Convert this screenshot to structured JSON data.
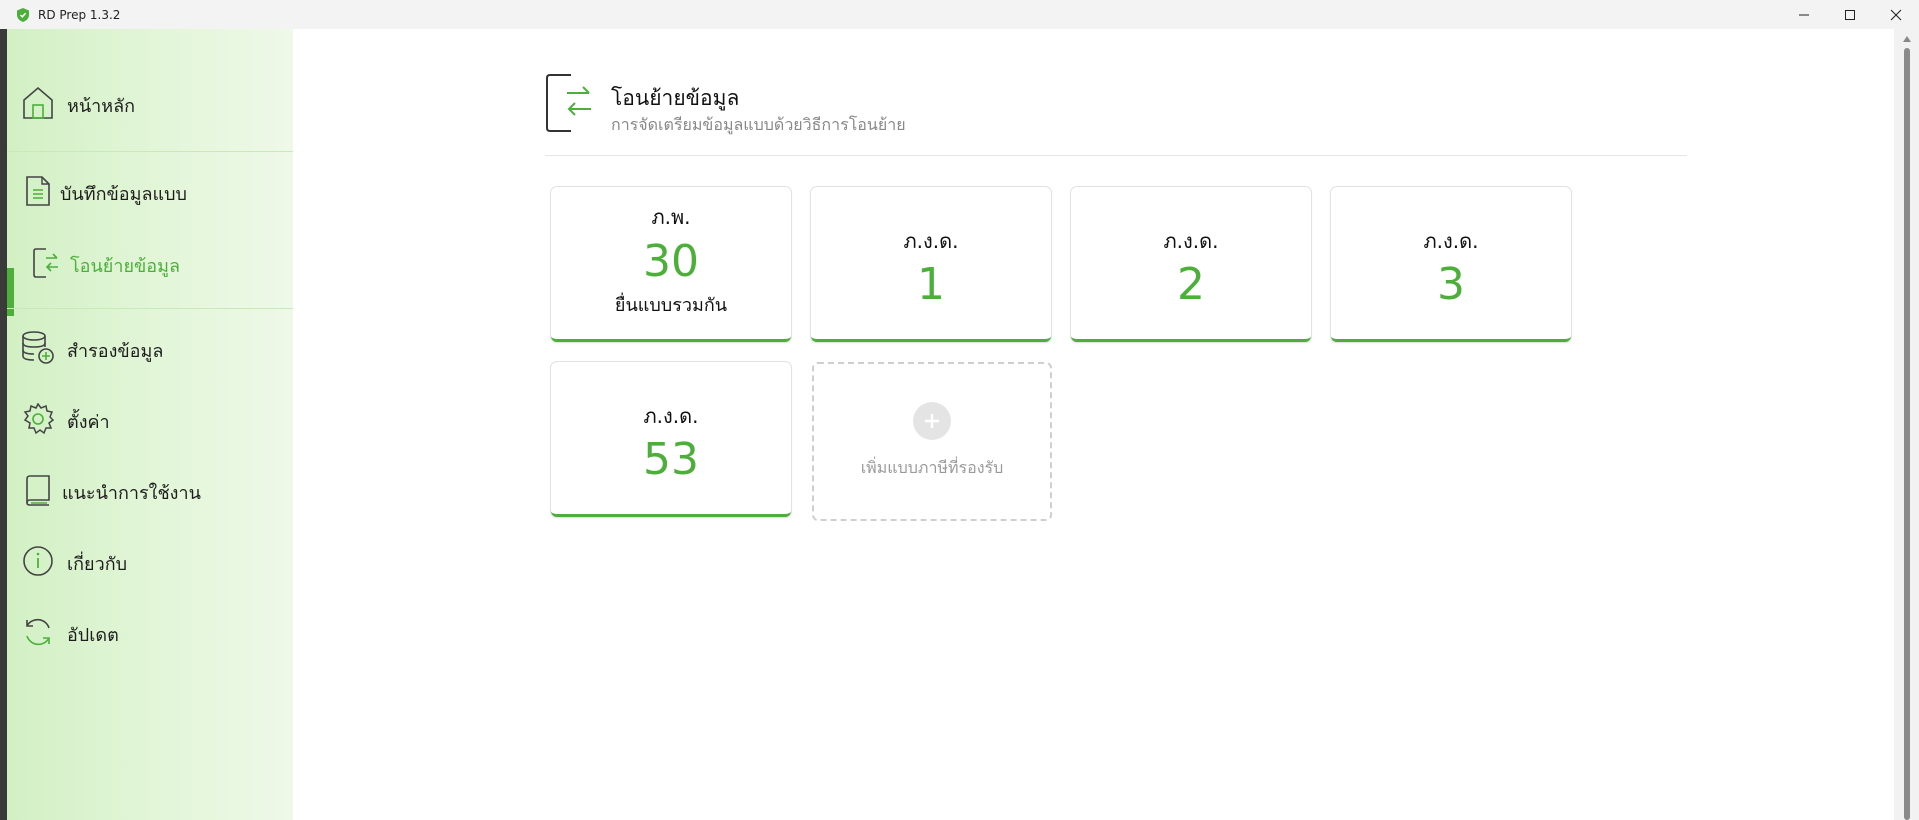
{
  "window": {
    "title": "RD Prep 1.3.2",
    "controls": [
      "minimize",
      "maximize",
      "close"
    ]
  },
  "colors": {
    "accent": "#4caf3a",
    "sidebar_bg": "#e3f6d9",
    "text_primary": "#111111",
    "text_muted": "#888888"
  },
  "sidebar": {
    "items": [
      {
        "label": "หน้าหลัก",
        "icon": "home-icon"
      },
      {
        "label": "บันทึกข้อมูลแบบ",
        "icon": "document-icon"
      },
      {
        "label": "โอนย้ายข้อมูล",
        "icon": "transfer-icon",
        "active": true
      },
      {
        "label": "สำรองข้อมูล",
        "icon": "database-backup-icon"
      },
      {
        "label": "ตั้งค่า",
        "icon": "gear-icon"
      },
      {
        "label": "แนะนำการใช้งาน",
        "icon": "book-icon"
      },
      {
        "label": "เกี่ยวกับ",
        "icon": "info-icon"
      },
      {
        "label": "อัปเดต",
        "icon": "refresh-icon"
      }
    ]
  },
  "page": {
    "title": "โอนย้ายข้อมูล",
    "subtitle": "การจัดเตรียมข้อมูลแบบด้วยวิธีการโอนย้าย",
    "icon": "transfer-icon"
  },
  "cards": [
    {
      "label": "ภ.พ.",
      "number": "30",
      "note": "ยื่นแบบรวมกัน"
    },
    {
      "label": "ภ.ง.ด.",
      "number": "1"
    },
    {
      "label": "ภ.ง.ด.",
      "number": "2"
    },
    {
      "label": "ภ.ง.ด.",
      "number": "3"
    },
    {
      "label": "ภ.ง.ด.",
      "number": "53"
    }
  ],
  "add_card": {
    "label": "เพิ่มแบบภาษีที่รองรับ",
    "icon": "plus-icon"
  }
}
